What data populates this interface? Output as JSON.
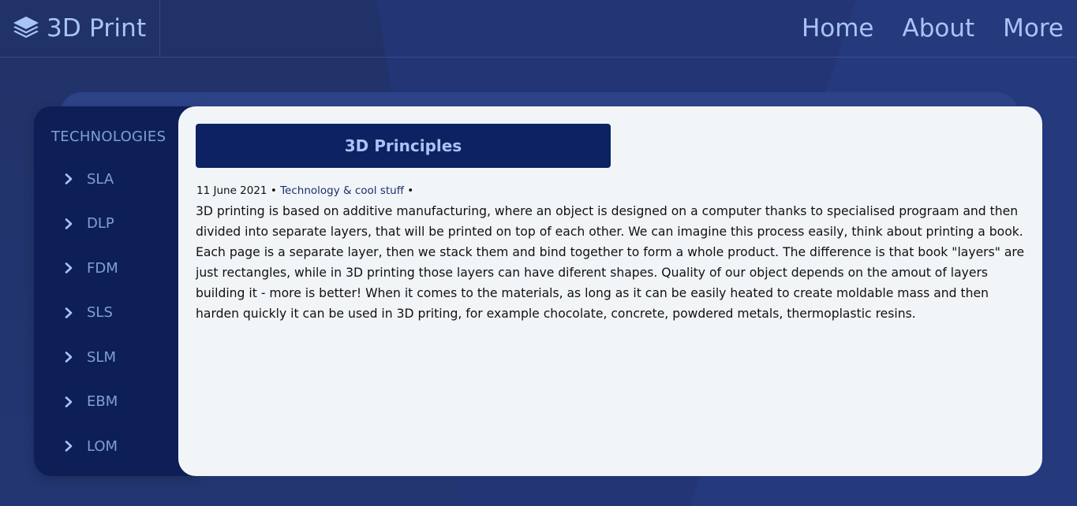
{
  "header": {
    "brand": "3D Print",
    "nav": [
      {
        "label": "Home"
      },
      {
        "label": "About"
      },
      {
        "label": "More"
      }
    ]
  },
  "sidebar": {
    "title": "TECHNOLOGIES",
    "items": [
      {
        "label": "SLA"
      },
      {
        "label": "DLP"
      },
      {
        "label": "FDM"
      },
      {
        "label": "SLS"
      },
      {
        "label": "SLM"
      },
      {
        "label": "EBM"
      },
      {
        "label": "LOM"
      }
    ]
  },
  "article": {
    "title": "3D Principles",
    "date": "11 June 2021",
    "separator": "•",
    "category": "Technology & cool stuff",
    "body": "3D printing is based on additive manufacturing, where an object is designed on a computer thanks to specialised prograam and then divided into separate layers, that will be printed on top of each other. We can imagine this process easily, think about printing a book. Each page is a separate layer, then we stack them and bind together to form a whole product. The difference is that book \"layers\" are just rectangles, while in 3D printing those layers can have diferent shapes. Quality of our object depends on the amout of layers building it - more is better! When it comes to the materials, as long as it can be easily heated to create moldable mass and then harden quickly it can be used in 3D priting, for example chocolate, concrete, powdered metals, thermoplastic resins."
  },
  "colors": {
    "background": "#233574",
    "sidebar": "#0d1f56",
    "title_box": "#0d2262",
    "accent_text": "#a8c4f6",
    "sidebar_text": "#7f9fd8",
    "content_bg": "#f1f5f8"
  },
  "icons": {
    "brand": "layers-icon",
    "sidebar_item": "chevron-right-icon"
  }
}
